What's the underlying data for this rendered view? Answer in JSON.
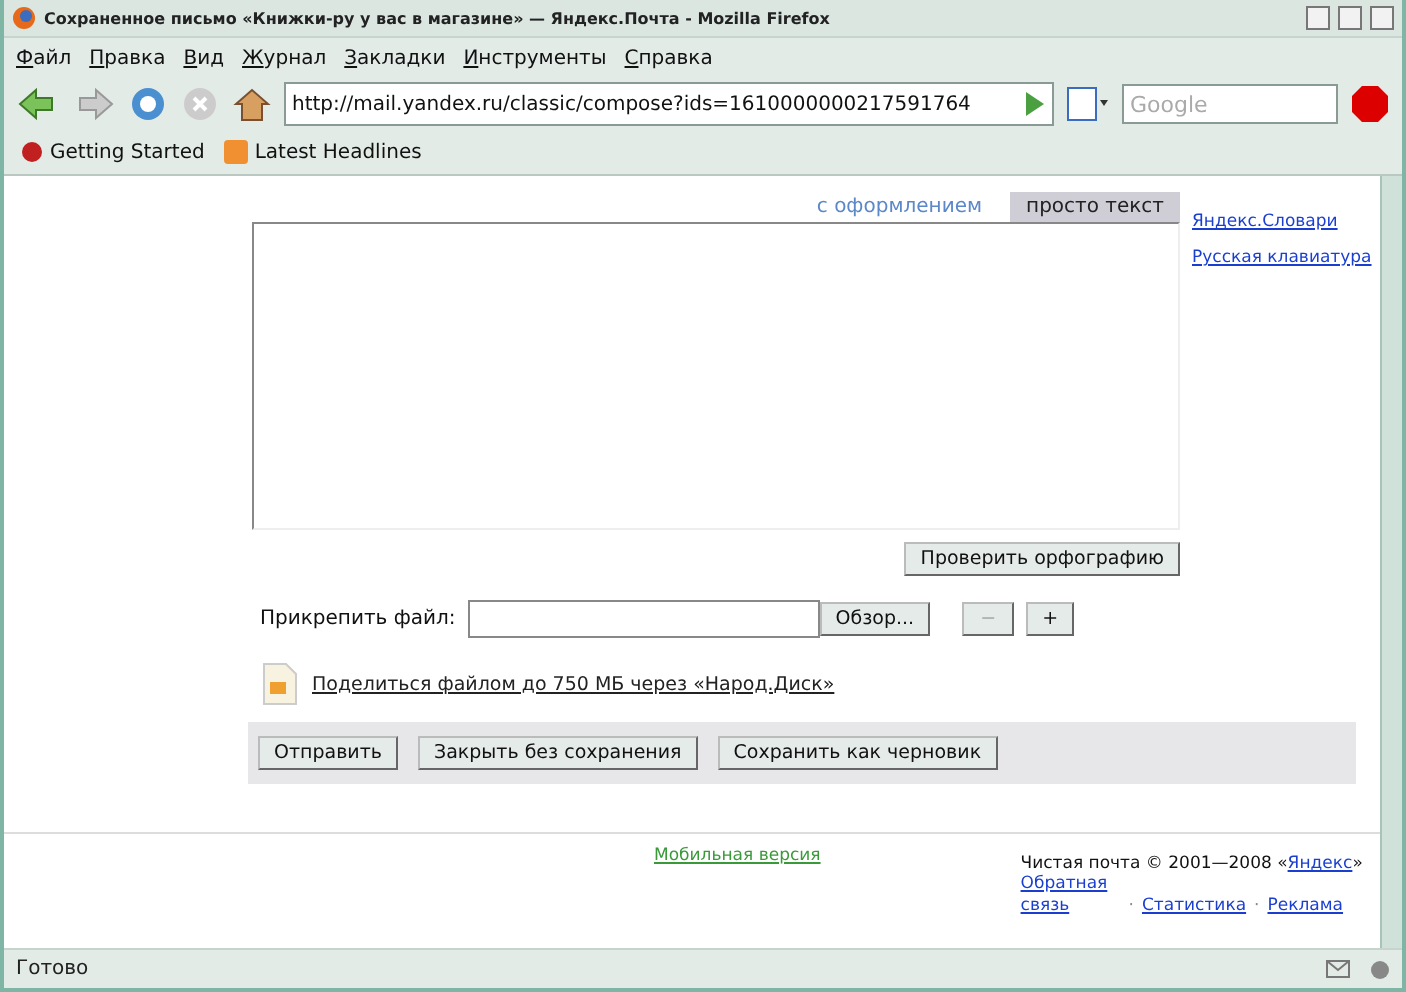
{
  "window": {
    "title": "Сохраненное письмо «Книжки-ру у вас в магазине» — Яндекс.Почта - Mozilla Firefox"
  },
  "menu": [
    "Файл",
    "Правка",
    "Вид",
    "Журнал",
    "Закладки",
    "Инструменты",
    "Справка"
  ],
  "toolbar": {
    "url": "http://mail.yandex.ru/classic/compose?ids=1610000000217591764",
    "search_placeholder": "Google"
  },
  "bookmarks": [
    "Getting Started",
    "Latest Headlines"
  ],
  "compose": {
    "format_tabs": [
      {
        "label": "с оформлением",
        "selected": false
      },
      {
        "label": "просто текст",
        "selected": true
      }
    ],
    "side_links": [
      "Яндекс.Словари",
      "Русская клавиатура"
    ],
    "spellcheck_button": "Проверить орфографию",
    "attach": {
      "label": "Прикрепить файл:",
      "browse_button": "Обзор...",
      "remove_button": {
        "label": "−",
        "disabled": true
      },
      "add_button": {
        "label": "+",
        "disabled": false
      }
    },
    "share_link": "Поделиться файлом до 750 МБ через «Народ.Диск»",
    "actions": [
      "Отправить",
      "Закрыть без сохранения",
      "Сохранить как черновик"
    ]
  },
  "footer": {
    "mobile_link": "Мобильная версия",
    "copyright_prefix": "Чистая почта © 2001—2008 «",
    "yandex_link": "Яндекс",
    "copyright_suffix": "»",
    "links": [
      "Обратная связь",
      "Статистика",
      "Реклама"
    ],
    "separator": "·"
  },
  "status_bar": {
    "text": "Готово"
  }
}
